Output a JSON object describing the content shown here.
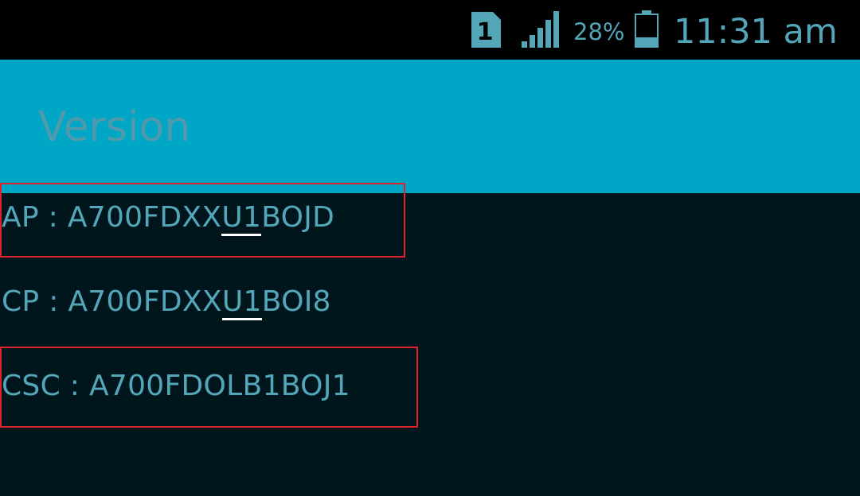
{
  "status_bar": {
    "sim_label": "1",
    "battery_percent": "28%",
    "battery_level": 0.28,
    "time": "11:31 am",
    "icons": [
      "sim-1-icon",
      "signal-icon",
      "battery-icon"
    ],
    "color": "#52a6b8"
  },
  "app_bar": {
    "title": "Version",
    "background": "#00a6c6"
  },
  "versions": {
    "ap": {
      "prefix": "AP : A700FDXX",
      "underlined": "U1",
      "suffix": "BOJD"
    },
    "cp": {
      "prefix": "CP : A700FDXX",
      "underlined": "U1",
      "suffix": "BOI8"
    },
    "csc": {
      "text": "CSC : A700FDOLB1BOJ1"
    }
  },
  "annotations": {
    "highlight_color": "#e0222c",
    "underline_color": "#ffffff"
  }
}
